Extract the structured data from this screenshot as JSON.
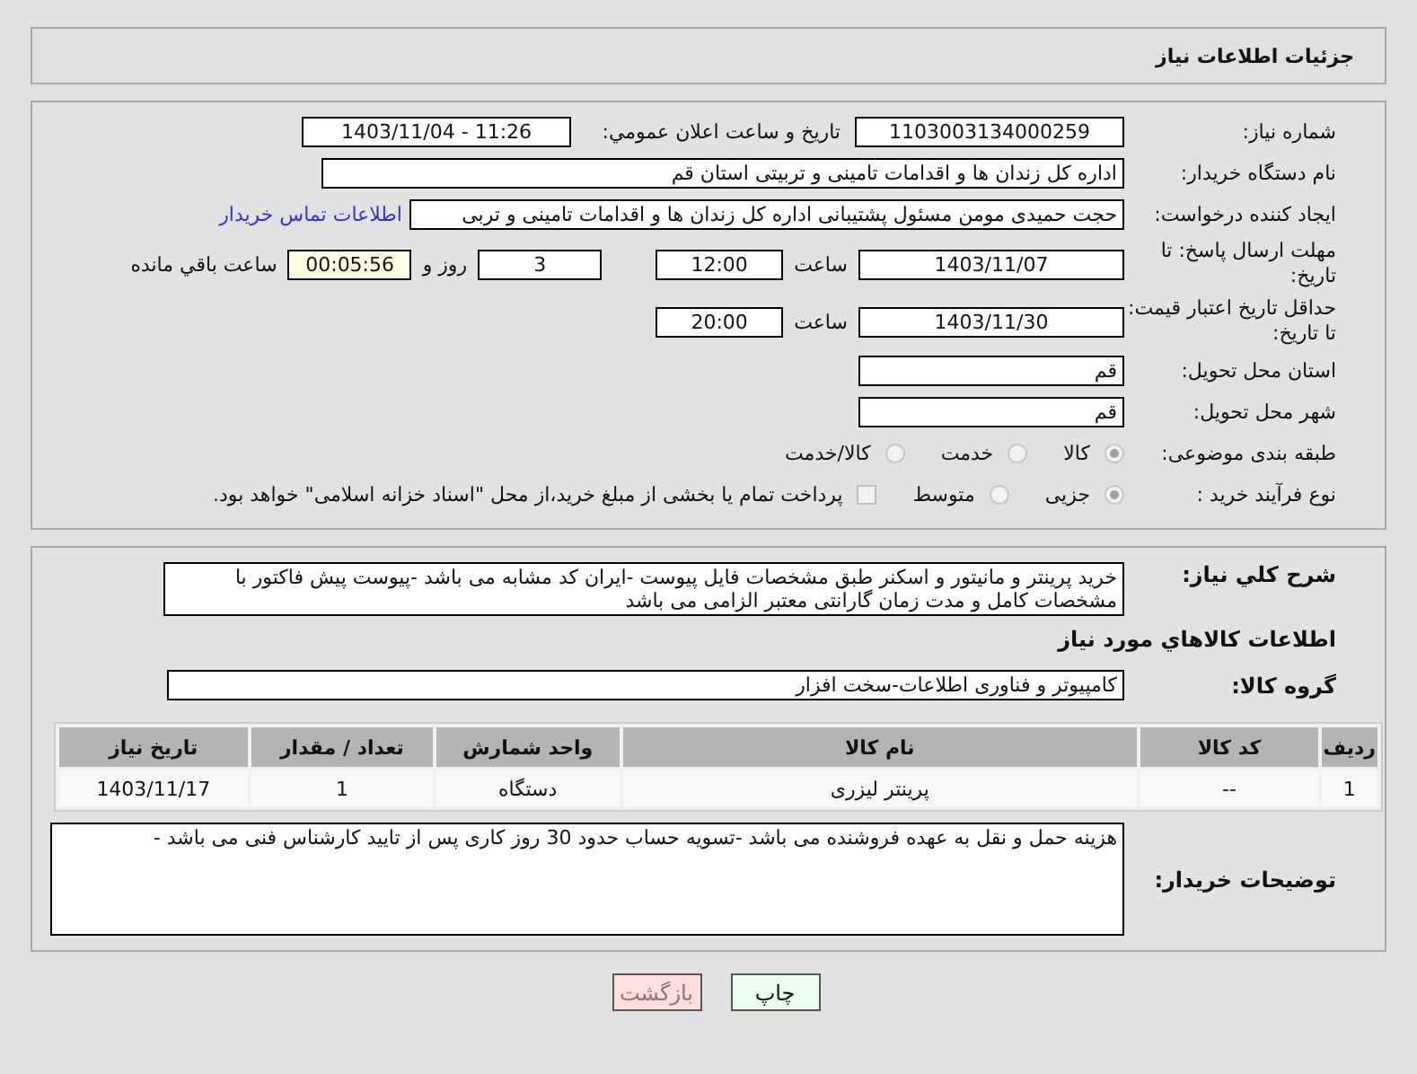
{
  "header_title": "جزئیات اطلاعات نیاز",
  "need_number": {
    "label": "شماره نیاز:",
    "value": "1103003134000259"
  },
  "announce": {
    "label": "تاریخ و ساعت اعلان عمومي:",
    "value": "1403/11/04 - 11:26"
  },
  "buyer_org": {
    "label": "نام دستگاه خریدار:",
    "value": "اداره کل زندان ها و اقدامات تامینی و تربیتی استان قم"
  },
  "requester": {
    "label": "ایجاد کننده درخواست:",
    "value": "حجت  حمیدی مومن مسئول پشتیبانی اداره کل زندان ها و اقدامات تامینی و تربی",
    "link": "اطلاعات تماس خریدار"
  },
  "reply_deadline": {
    "label": "مهلت ارسال پاسخ: تا تاریخ:",
    "date": "1403/11/07",
    "time_label": "ساعت",
    "time": "12:00",
    "days": "3",
    "days_label": "روز و",
    "remaining": "00:05:56",
    "remaining_label": "ساعت باقي مانده"
  },
  "price_validity": {
    "label": "حداقل تاریخ اعتبار قیمت: تا تاریخ:",
    "date": "1403/11/30",
    "time_label": "ساعت",
    "time": "20:00"
  },
  "province": {
    "label": "استان محل تحویل:",
    "value": "قم"
  },
  "city": {
    "label": "شهر محل تحویل:",
    "value": "قم"
  },
  "category": {
    "label": "طبقه بندی موضوعی:",
    "options": [
      {
        "label": "کالا",
        "selected": true
      },
      {
        "label": "خدمت",
        "selected": false
      },
      {
        "label": "کالا/خدمت",
        "selected": false
      }
    ]
  },
  "process": {
    "label": "نوع فرآیند خرید :",
    "options": [
      {
        "label": "جزیی",
        "selected": true
      },
      {
        "label": "متوسط",
        "selected": false
      }
    ],
    "treasury": {
      "label": "پرداخت تمام یا بخشی از مبلغ خرید،از محل \"اسناد خزانه اسلامی\" خواهد بود.",
      "checked": false
    }
  },
  "description": {
    "label": "شرح کلي نیاز:",
    "text": "خرید پرینتر و مانیتور و اسکنر طبق مشخصات فایل پیوست -ایران کد مشابه می باشد -پیوست پیش فاکتور با مشخصات کامل و مدت زمان گارانتی معتبر الزامی می باشد"
  },
  "goods_heading": "اطلاعات کالاهاي مورد نیاز",
  "goods_group": {
    "label": "گروه کالا:",
    "value": "کامپیوتر و فناوری اطلاعات-سخت افزار"
  },
  "table": {
    "columns": [
      "ردیف",
      "کد کالا",
      "نام کالا",
      "واحد شمارش",
      "تعداد / مقدار",
      "تاریخ نیاز"
    ],
    "rows": [
      [
        "1",
        "--",
        "پرینتر لیزری",
        "دستگاه",
        "1",
        "1403/11/17"
      ]
    ]
  },
  "buyer_notes": {
    "label": "توضیحات خریدار:",
    "text": "هزینه حمل و نقل به عهده فروشنده می باشد -تسویه حساب حدود 30 روز کاری پس از تایید کارشناس فنی  می باشد -"
  },
  "buttons": [
    {
      "label": "چاپ",
      "kind": "print"
    },
    {
      "label": "بازگشت",
      "kind": "back"
    }
  ]
}
